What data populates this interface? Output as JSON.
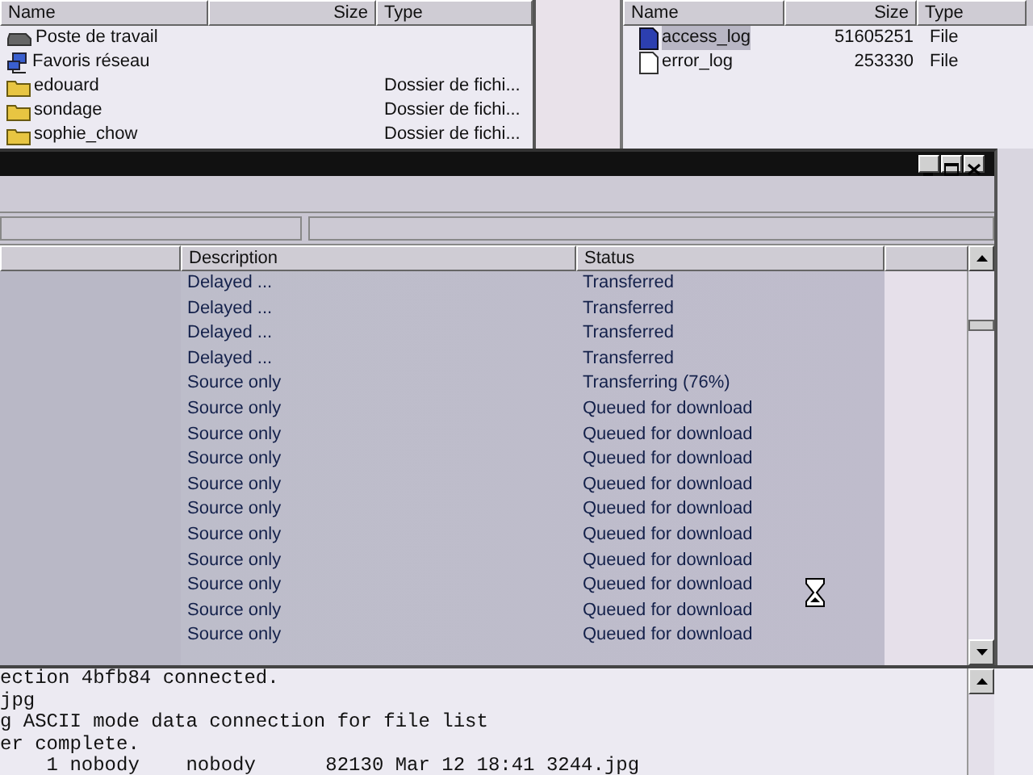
{
  "local_panel": {
    "columns": [
      "Name",
      "Size",
      "Type"
    ],
    "rows": [
      {
        "name": "Poste de travail",
        "kind": "drive",
        "type": ""
      },
      {
        "name": "Favoris réseau",
        "kind": "network",
        "type": ""
      },
      {
        "name": "edouard",
        "kind": "folder",
        "type": "Dossier de fichi..."
      },
      {
        "name": "sondage",
        "kind": "folder",
        "type": "Dossier de fichi..."
      },
      {
        "name": "sophie_chow",
        "kind": "folder",
        "type": "Dossier de fichi..."
      }
    ]
  },
  "remote_panel": {
    "columns": [
      "Name",
      "Size",
      "Type"
    ],
    "rows": [
      {
        "name": "access_log",
        "size": "51605251",
        "type": "File",
        "kind": "file-blue",
        "selected": true
      },
      {
        "name": "error_log",
        "size": "253330",
        "type": "File",
        "kind": "file",
        "selected": false
      }
    ]
  },
  "queue_window": {
    "columns": [
      "Description",
      "Status"
    ],
    "rows": [
      {
        "description": "Delayed ...",
        "status": "Transferred"
      },
      {
        "description": "Delayed ...",
        "status": "Transferred"
      },
      {
        "description": "Delayed ...",
        "status": "Transferred"
      },
      {
        "description": "Delayed ...",
        "status": "Transferred"
      },
      {
        "description": "Source only",
        "status": "Transferring (76%)"
      },
      {
        "description": "Source only",
        "status": "Queued for download"
      },
      {
        "description": "Source only",
        "status": "Queued for download"
      },
      {
        "description": "Source only",
        "status": "Queued for download"
      },
      {
        "description": "Source only",
        "status": "Queued for download"
      },
      {
        "description": "Source only",
        "status": "Queued for download"
      },
      {
        "description": "Source only",
        "status": "Queued for download"
      },
      {
        "description": "Source only",
        "status": "Queued for download"
      },
      {
        "description": "Source only",
        "status": "Queued for download"
      },
      {
        "description": "Source only",
        "status": "Queued for download"
      },
      {
        "description": "Source only",
        "status": "Queued for download"
      }
    ]
  },
  "log": [
    "ection 4bfb84 connected.",
    "jpg",
    "g ASCII mode data connection for file list",
    "er complete.",
    "    1 nobody    nobody      82130 Mar 12 18:41 3244.jpg"
  ]
}
